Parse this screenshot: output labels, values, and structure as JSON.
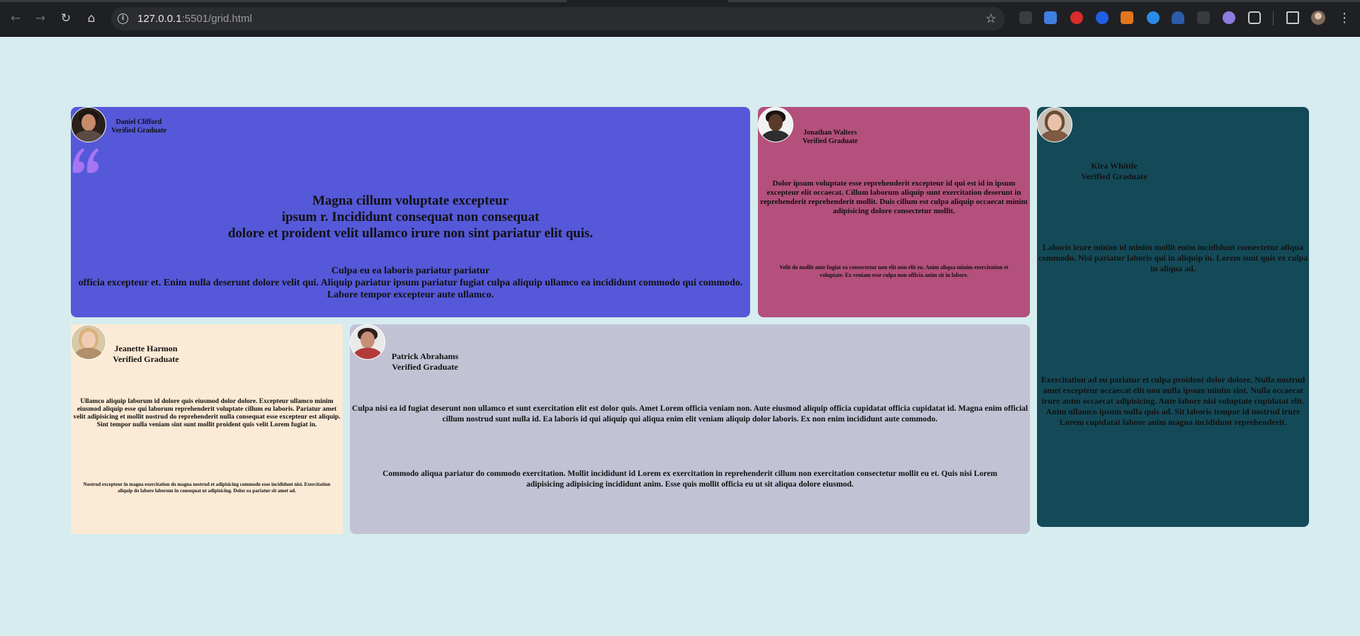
{
  "browser": {
    "url_host": "127.0.0.1",
    "url_rest": ":5501/grid.html"
  },
  "cards": {
    "daniel": {
      "name": "Daniel Clifford",
      "role": "Verified Graduate",
      "headline_1": "Magna cillum voluptate excepteur",
      "headline_2": "ipsum r. Incididunt consequat non consequat",
      "headline_3": "dolore et proident velit ullamco irure non sint pariatur elit quis.",
      "body_1": "Culpa eu ea laboris pariatur pariatur",
      "body_2": "officia excepteur et. Enim nulla deserunt dolore velit qui. Aliquip pariatur ipsum pariatur fugiat culpa aliquip ullamco ea incididunt commodo qui commodo. Labore tempor excepteur aute ullamco."
    },
    "jonathan": {
      "name": "Jonathan Walters",
      "role": "Verified Graduate",
      "body_1": "Dolor ipsum voluptate esse reprehenderit excepteur id qui est id in ipsum excepteur elit occaecat. Cillum laborum aliquip sunt exercitation deserunt in reprehenderit reprehenderit mollit. Duis cillum est culpa aliquip occaecat minim adipisicing dolore consectetur mollit.",
      "body_2": "Velit do mollit aute fugiat ea consectetur non elit non elit eu. Anim aliqua minim exercitation et voluptate. Ex veniam esse culpa non officia anim sit in labore."
    },
    "kira": {
      "name": "Kira Whittle",
      "role": "Verified Graduate",
      "body_1": "Laboris irure minim id minim mollit enim incididunt consectetur aliqua commodo. Nisi pariatur laboris qui in aliquip in. Lorem sunt quis ex culpa in aliqua ad.",
      "body_2": "Exercitation ad eu pariatur et culpa proident dolor dolore. Nulla nostrud amet excepteur occaecat elit non nulla ipsum minim sint. Nulla occaecat irure anim occaecat adipisicing. Aute labore nisi voluptate cupidatat elit. Anim ullamco ipsum nulla quis ad. Sit laboris tempor id nostrud irure Lorem cupidatat labore anim magna incididunt reprehenderit."
    },
    "jeanette": {
      "name": "Jeanette Harmon",
      "role": "Verified Graduate",
      "body_1": "Ullamco aliquip laborum id dolore quis eiusmod dolor dolore. Excepteur ullamco minim eiusmod aliquip esse qui laborum reprehenderit voluptate cillum eu laboris. Pariatur amet velit adipisicing et mollit nostrud do reprehenderit nulla consequat esse excepteur est aliquip. Sint tempor nulla veniam sint sunt mollit proident quis velit Lorem fugiat in.",
      "body_2": "Nostrud excepteur in magna exercitation do magna nostrud et adipisicing commodo esse incididunt nisi. Exercitation aliquip do labore laborum in consequat ut adipisicing. Dolor ea pariatur sit amet ad."
    },
    "patrick": {
      "name": "Patrick Abrahams",
      "role": "Verified Graduate",
      "body_1": "Culpa nisi ea id fugiat deserunt non ullamco et sunt exercitation elit est dolor quis. Amet Lorem officia veniam non. Aute eiusmod aliquip officia cupidatat officia cupidatat id. Magna enim official cillum nostrud sunt nulla id. Ea laboris id qui aliquip qui aliqua enim elit veniam aliquip dolor laboris. Ex non enim incididunt aute commodo.",
      "body_2": "Commodo aliqua pariatur do commodo exercitation. Mollit incididunt id Lorem ex exercitation in reprehenderit cillum non exercitation consectetur mollit eu et. Quis nisi Lorem adipisicing adipisicing incididunt anim. Esse quis mollit officia eu ut sit aliqua dolore eiusmod."
    }
  },
  "colors": {
    "page_bg": "#d6ecef",
    "daniel_bg": "#5558d8",
    "jonathan_bg": "#b3507b",
    "kira_bg": "#144a58",
    "jeanette_bg": "#fbead5",
    "patrick_bg": "#c2c2d5",
    "quote_mark": "#a775f1"
  },
  "icons": [
    "back-arrow-icon",
    "forward-arrow-icon",
    "reload-icon",
    "home-icon",
    "site-info-icon",
    "bookmark-star-icon",
    "extensions-puzzle-icon",
    "side-panel-icon",
    "quote-mark-icon"
  ]
}
